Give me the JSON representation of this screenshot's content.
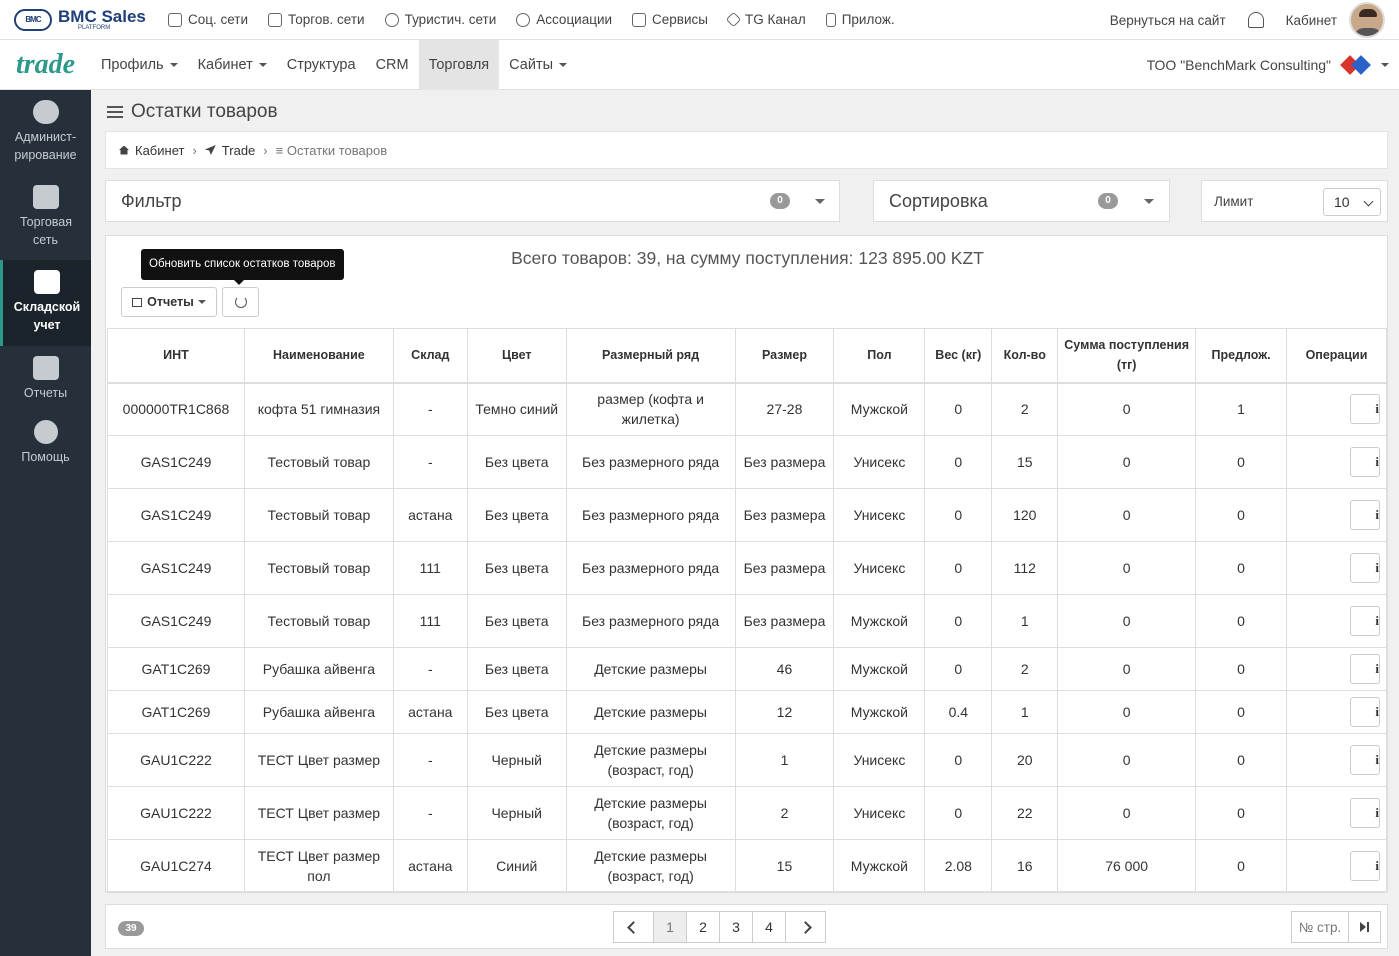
{
  "topbar": {
    "logo_badge": "BMC",
    "logo_title": "BMC Sales",
    "logo_sub": "PLATFORM",
    "nav": [
      {
        "label": "Соц. сети",
        "icon": "chat-icon"
      },
      {
        "label": "Торгов. сети",
        "icon": "cart-icon"
      },
      {
        "label": "Туристич. сети",
        "icon": "globe-icon"
      },
      {
        "label": "Ассоциации",
        "icon": "globe-icon"
      },
      {
        "label": "Сервисы",
        "icon": "inbox-icon"
      },
      {
        "label": "TG Канал",
        "icon": "send-icon"
      },
      {
        "label": "Прилож.",
        "icon": "phone-icon"
      }
    ],
    "back_link": "Вернуться на сайт",
    "cabinet_link": "Кабинет"
  },
  "secbar": {
    "brand": "trade",
    "menu": [
      {
        "label": "Профиль",
        "caret": true
      },
      {
        "label": "Кабинет",
        "caret": true
      },
      {
        "label": "Структура",
        "caret": false
      },
      {
        "label": "CRM",
        "caret": false
      },
      {
        "label": "Торговля",
        "caret": false,
        "active": true
      },
      {
        "label": "Сайты",
        "caret": true
      }
    ],
    "company": "ТОО \"BenchMark Consulting\""
  },
  "sidebar": [
    {
      "label": "Админист-рирование",
      "icon": "gears-icon"
    },
    {
      "label": "Торговая сеть",
      "icon": "store-icon"
    },
    {
      "label": "Складской учет",
      "icon": "warehouse-icon",
      "active": true
    },
    {
      "label": "Отчеты",
      "icon": "share-icon"
    },
    {
      "label": "Помощь",
      "icon": "question-icon"
    }
  ],
  "page": {
    "title": "Остатки товаров",
    "breadcrumb": [
      "Кабинет",
      "Trade",
      "Остатки товаров"
    ]
  },
  "filter": {
    "title": "Фильтр",
    "count": "0"
  },
  "sort": {
    "title": "Сортировка",
    "count": "0"
  },
  "limit": {
    "label": "Лимит",
    "value": "10"
  },
  "summary": "Всего товаров: 39, на сумму поступления: 123 895.00 KZT",
  "tooltip": "Обновить список остатков товаров",
  "reports_button": "Отчеты",
  "table": {
    "headers": [
      "ИНТ",
      "Наименование",
      "Склад",
      "Цвет",
      "Размерный ряд",
      "Размер",
      "Пол",
      "Вес (кг)",
      "Кол-во",
      "Сумма поступления (тг)",
      "Предлож.",
      "Операции"
    ],
    "rows": [
      [
        "000000TR1C868",
        "кофта 51 гимназия",
        "-",
        "Темно синий",
        "размер (кофта и жилетка)",
        "27-28",
        "Мужской",
        "0",
        "2",
        "0",
        "1"
      ],
      [
        "GAS1C249",
        "Тестовый товар",
        "-",
        "Без цвета",
        "Без размерного ряда",
        "Без размера",
        "Унисекс",
        "0",
        "15",
        "0",
        "0"
      ],
      [
        "GAS1C249",
        "Тестовый товар",
        "астана",
        "Без цвета",
        "Без размерного ряда",
        "Без размера",
        "Унисекс",
        "0",
        "120",
        "0",
        "0"
      ],
      [
        "GAS1C249",
        "Тестовый товар",
        "111",
        "Без цвета",
        "Без размерного ряда",
        "Без размера",
        "Унисекс",
        "0",
        "112",
        "0",
        "0"
      ],
      [
        "GAS1C249",
        "Тестовый товар",
        "111",
        "Без цвета",
        "Без размерного ряда",
        "Без размера",
        "Мужской",
        "0",
        "1",
        "0",
        "0"
      ],
      [
        "GAT1C269",
        "Рубашка айвенга",
        "-",
        "Без цвета",
        "Детские размеры",
        "46",
        "Мужской",
        "0",
        "2",
        "0",
        "0"
      ],
      [
        "GAT1C269",
        "Рубашка айвенга",
        "астана",
        "Без цвета",
        "Детские размеры",
        "12",
        "Мужской",
        "0.4",
        "1",
        "0",
        "0"
      ],
      [
        "GAU1C222",
        "ТЕСТ Цвет размер",
        "-",
        "Черный",
        "Детские размеры (возраст, год)",
        "1",
        "Унисекс",
        "0",
        "20",
        "0",
        "0"
      ],
      [
        "GAU1C222",
        "ТЕСТ Цвет размер",
        "-",
        "Черный",
        "Детские размеры (возраст, год)",
        "2",
        "Унисекс",
        "0",
        "22",
        "0",
        "0"
      ],
      [
        "GAU1C274",
        "ТЕСТ Цвет размер пол",
        "астана",
        "Синий",
        "Детские размеры (возраст, год)",
        "15",
        "Мужской",
        "2.08",
        "16",
        "76 000",
        "0"
      ]
    ],
    "info_label": "i"
  },
  "pager": {
    "total_badge": "39",
    "pages": [
      "1",
      "2",
      "3",
      "4"
    ],
    "current": "1",
    "page_input_placeholder": "№ стр."
  }
}
